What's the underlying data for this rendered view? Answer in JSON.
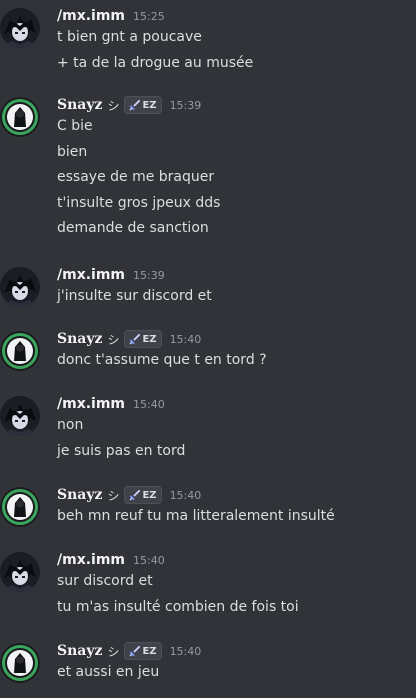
{
  "colors": {
    "background": "#313338",
    "ring": "#3ba55c",
    "text": "#dbdee1",
    "muted": "#949ba4"
  },
  "messages": [
    {
      "author": "/mx.imm",
      "avatar": "dark-character-avatar",
      "time": "15:25",
      "lines": [
        "t bien gnt a poucave",
        "+ ta de la drogue au musée"
      ]
    },
    {
      "author": "Snayz",
      "symbol": "シ",
      "tag": "EZ",
      "avatar": "green-ring-avatar",
      "time": "15:39",
      "lines": [
        "C bie",
        "bien",
        "essaye de me braquer",
        "t'insulte gros jpeux dds",
        "demande de sanction"
      ]
    },
    {
      "author": "/mx.imm",
      "avatar": "dark-character-avatar",
      "time": "15:39",
      "lines": [
        "j'insulte sur discord et"
      ]
    },
    {
      "author": "Snayz",
      "symbol": "シ",
      "tag": "EZ",
      "avatar": "green-ring-avatar",
      "time": "15:40",
      "lines": [
        "donc t'assume que t en tord ?"
      ]
    },
    {
      "author": "/mx.imm",
      "avatar": "dark-character-avatar",
      "time": "15:40",
      "lines": [
        "non",
        "je suis pas en tord"
      ]
    },
    {
      "author": "Snayz",
      "symbol": "シ",
      "tag": "EZ",
      "avatar": "green-ring-avatar",
      "time": "15:40",
      "lines": [
        "beh mn reuf tu ma litteralement insulté"
      ]
    },
    {
      "author": "/mx.imm",
      "avatar": "dark-character-avatar",
      "time": "15:40",
      "lines": [
        "sur discord et",
        "tu m'as insulté combien de fois toi"
      ]
    },
    {
      "author": "Snayz",
      "symbol": "シ",
      "tag": "EZ",
      "avatar": "green-ring-avatar",
      "time": "15:40",
      "lines": [
        "et aussi en jeu"
      ]
    }
  ]
}
